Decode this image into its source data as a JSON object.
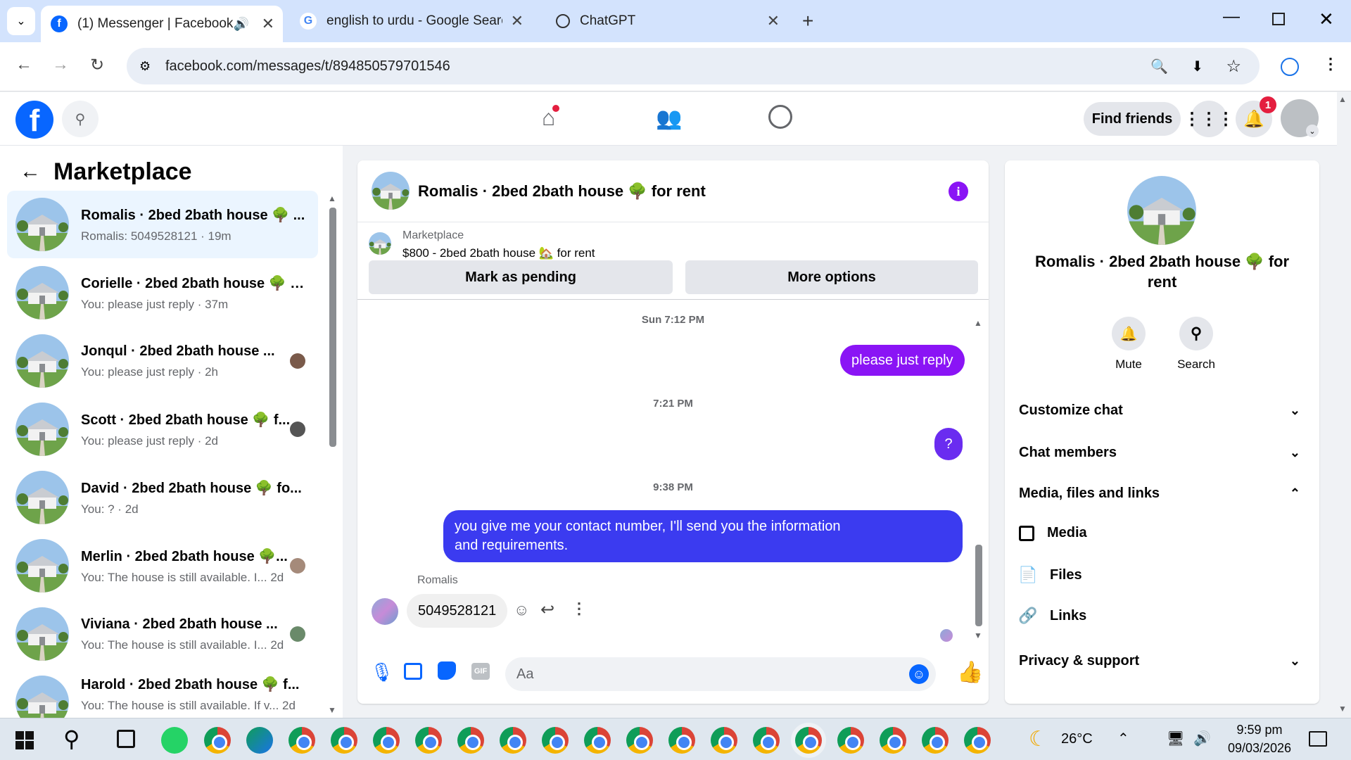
{
  "browser": {
    "tabs": [
      {
        "title": "(1) Messenger | Facebook"
      },
      {
        "title": "english to urdu - Google Search"
      },
      {
        "title": "ChatGPT"
      }
    ],
    "url": "facebook.com/messages/t/894850579701546"
  },
  "header": {
    "find_friends": "Find friends",
    "notification_count": "1"
  },
  "sidebar": {
    "title": "Marketplace",
    "conversations": [
      {
        "name": "Romalis · 2bed 2bath house 🌳 ...",
        "snippet": "Romalis: 5049528121 · 19m"
      },
      {
        "name": "Corielle · 2bed 2bath house 🌳 f...",
        "snippet": "You: please just reply · 37m"
      },
      {
        "name": "Jonqul · 2bed 2bath house ...",
        "snippet": "You: please just reply · 2h"
      },
      {
        "name": "Scott · 2bed 2bath house 🌳 f...",
        "snippet": "You: please just reply · 2d"
      },
      {
        "name": "David · 2bed 2bath house 🌳 fo...",
        "snippet": "You: ? · 2d"
      },
      {
        "name": "Merlin · 2bed 2bath house 🌳...",
        "snippet": "You: The house is still available. I...  2d"
      },
      {
        "name": "Viviana · 2bed 2bath house ...",
        "snippet": "You: The house is still available. I...  2d"
      },
      {
        "name": "Harold · 2bed 2bath house 🌳 f...",
        "snippet": "You: The house is still available. If v...  2d"
      }
    ]
  },
  "chat": {
    "title": "Romalis · 2bed 2bath house 🌳 for rent",
    "listing_source": "Marketplace",
    "listing_title": "$800 - 2bed 2bath house 🏡 for rent",
    "mark_pending": "Mark as pending",
    "more_options": "More options",
    "timestamps": [
      "Sun 7:12 PM",
      "7:21 PM",
      "9:38 PM"
    ],
    "messages": [
      {
        "from": "me",
        "text": "please just reply"
      },
      {
        "from": "me",
        "text": "?"
      },
      {
        "from": "me",
        "text": "you give me your contact number, I'll send you the information and requirements."
      },
      {
        "from": "Romalis",
        "text": "5049528121"
      }
    ],
    "sender_name": "Romalis",
    "composer_placeholder": "Aa"
  },
  "details": {
    "name": "Romalis · 2bed 2bath house 🌳 for rent",
    "mute": "Mute",
    "search": "Search",
    "sections": [
      "Customize chat",
      "Chat members",
      "Media, files and links",
      "Privacy & support"
    ],
    "media_items": [
      "Media",
      "Files",
      "Links"
    ]
  },
  "taskbar": {
    "weather": "26°C",
    "time": "9:59 pm",
    "date": "09/03/2026"
  },
  "colors": {
    "fb_blue": "#0866ff",
    "purple_bubble": "#8a14f5",
    "indigo_bubble": "#3b3bf0"
  }
}
